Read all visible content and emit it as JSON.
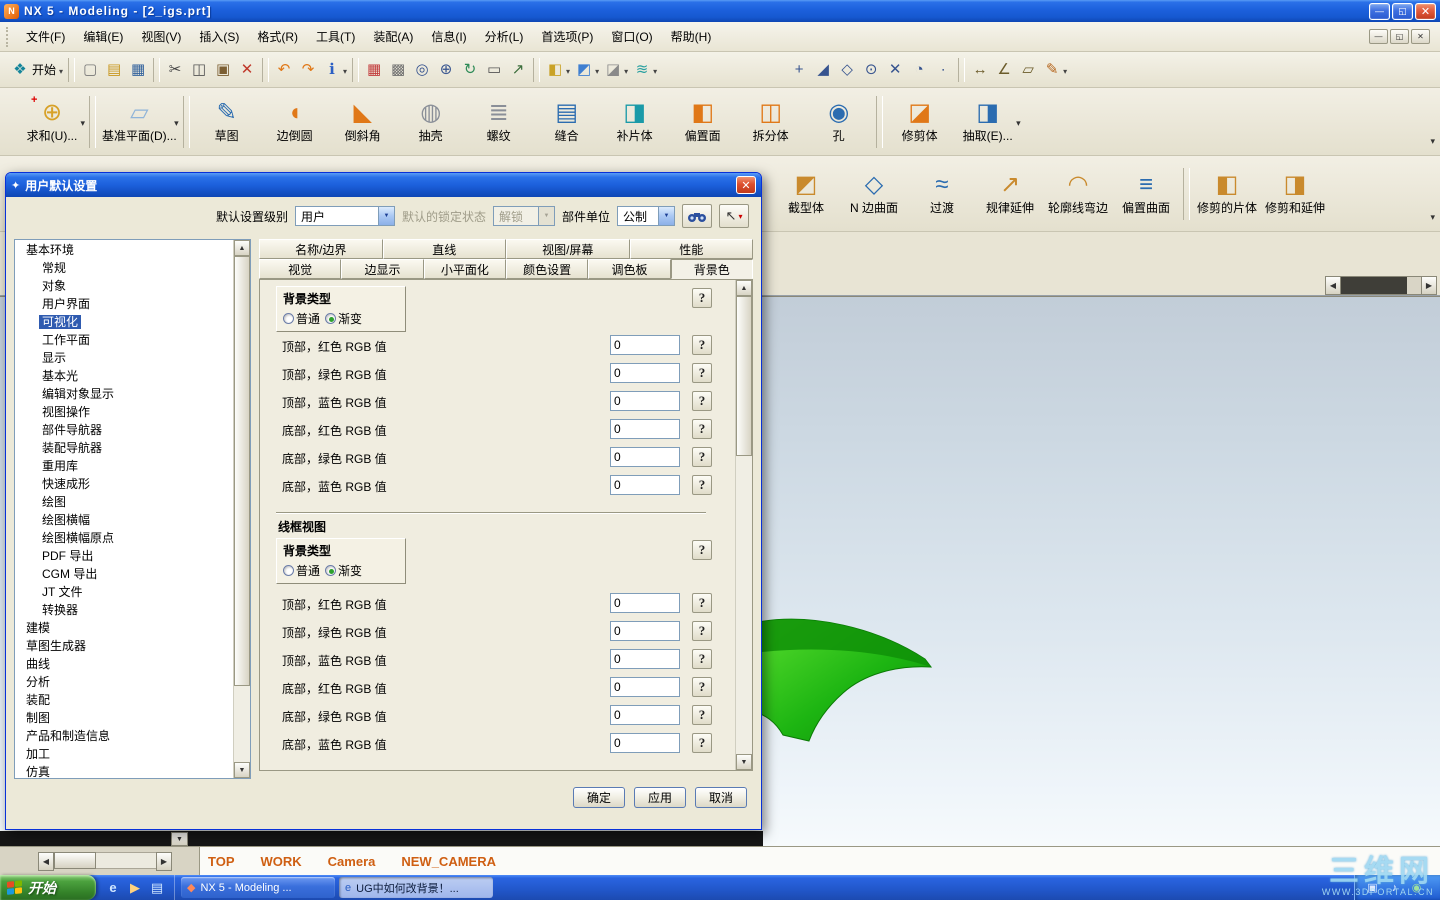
{
  "titlebar": {
    "title": "NX 5 - Modeling - [2_igs.prt]"
  },
  "menubar": {
    "items": [
      "文件(F)",
      "编辑(E)",
      "视图(V)",
      "插入(S)",
      "格式(R)",
      "工具(T)",
      "装配(A)",
      "信息(I)",
      "分析(L)",
      "首选项(P)",
      "窗口(O)",
      "帮助(H)"
    ]
  },
  "toolbar_small": {
    "items": [
      {
        "name": "nx-start-menu-button",
        "label": "开始",
        "glyph": "❖",
        "color": "#14859a",
        "caret": true
      },
      {
        "sep": true
      },
      {
        "name": "new-icon",
        "glyph": "▢",
        "color": "#777777"
      },
      {
        "name": "open-icon",
        "glyph": "▤",
        "color": "#c8971f"
      },
      {
        "name": "save-icon",
        "glyph": "▦",
        "color": "#33629c"
      },
      {
        "sep": true
      },
      {
        "name": "cut-icon",
        "glyph": "✂",
        "color": "#444444"
      },
      {
        "name": "copy-icon",
        "glyph": "◫",
        "color": "#555555"
      },
      {
        "name": "paste-icon",
        "glyph": "▣",
        "color": "#7c5f33"
      },
      {
        "name": "delete-icon",
        "glyph": "✕",
        "color": "#c0392b"
      },
      {
        "sep": true
      },
      {
        "name": "undo-icon",
        "glyph": "↶",
        "color": "#e07818"
      },
      {
        "name": "redo-icon",
        "glyph": "↷",
        "color": "#e07818"
      },
      {
        "name": "information-icon",
        "glyph": "ℹ",
        "color": "#2b5fc4",
        "caret": true
      },
      {
        "sep": true
      },
      {
        "name": "datum-display-icon",
        "glyph": "▦",
        "color": "#c23b3b"
      },
      {
        "name": "shaded-display-icon",
        "glyph": "▩",
        "color": "#6f6f6f"
      },
      {
        "name": "fit-view-icon",
        "glyph": "◎",
        "color": "#37548f"
      },
      {
        "name": "zoom-icon",
        "glyph": "⊕",
        "color": "#37548f"
      },
      {
        "name": "rotate-view-icon",
        "glyph": "↻",
        "color": "#2e8b57"
      },
      {
        "name": "snapshot-icon",
        "glyph": "▭",
        "color": "#555555"
      },
      {
        "name": "export-image-icon",
        "glyph": "↗",
        "color": "#3c6e3c"
      },
      {
        "sep": true
      },
      {
        "name": "orient-view-icon",
        "glyph": "◧",
        "color": "#c9a227",
        "caret": true
      },
      {
        "name": "isometric-view-icon",
        "glyph": "◩",
        "color": "#3f7fd1",
        "caret": true
      },
      {
        "name": "render-style-icon",
        "glyph": "◪",
        "color": "#8a8a8a",
        "caret": true
      },
      {
        "name": "palette-icon",
        "glyph": "≋",
        "color": "#2aa0a0",
        "caret": true
      },
      {
        "gap": true
      },
      {
        "name": "snap-point-icon",
        "glyph": "+",
        "color": "#37548f"
      },
      {
        "name": "snap-endpoint-icon",
        "glyph": "◢",
        "color": "#37548f"
      },
      {
        "name": "snap-midpoint-icon",
        "glyph": "◇",
        "color": "#37548f"
      },
      {
        "name": "snap-center-icon",
        "glyph": "⊙",
        "color": "#37548f"
      },
      {
        "name": "snap-intersection-icon",
        "glyph": "✕",
        "color": "#37548f"
      },
      {
        "name": "snap-quadrant-icon",
        "glyph": "◔",
        "color": "#37548f"
      },
      {
        "name": "snap-node-icon",
        "glyph": "∙",
        "color": "#37548f"
      },
      {
        "sep": true
      },
      {
        "name": "measure-distance-icon",
        "glyph": "↔",
        "color": "#6b5b2a"
      },
      {
        "name": "measure-angle-icon",
        "glyph": "∠",
        "color": "#6b5b2a"
      },
      {
        "name": "measure-body-icon",
        "glyph": "▱",
        "color": "#6b5b2a"
      },
      {
        "name": "annotation-icon",
        "glyph": "✎",
        "color": "#b5651d",
        "caret": true
      }
    ]
  },
  "toolbar_features": {
    "items": [
      {
        "name": "feature-unite-button",
        "label": "求和(U)...",
        "glyph": "⊕",
        "color": "#d7a128",
        "caret": true,
        "plus": true
      },
      {
        "sep": true
      },
      {
        "name": "feature-datum-plane-button",
        "label": "基准平面(D)...",
        "glyph": "▱",
        "color": "#8fb4d9",
        "caret": true
      },
      {
        "sep": true
      },
      {
        "name": "feature-sketch-button",
        "label": "草图",
        "glyph": "✎",
        "color": "#2b6cb0"
      },
      {
        "name": "feature-edge-blend-button",
        "label": "边倒圆",
        "glyph": "◖",
        "color": "#e07818"
      },
      {
        "name": "feature-chamfer-button",
        "label": "倒斜角",
        "glyph": "◣",
        "color": "#e07818"
      },
      {
        "name": "feature-shell-button",
        "label": "抽壳",
        "glyph": "◍",
        "color": "#8a8f98"
      },
      {
        "name": "feature-thread-button",
        "label": "螺纹",
        "glyph": "≣",
        "color": "#8a8f98"
      },
      {
        "name": "feature-sew-button",
        "label": "缝合",
        "glyph": "▤",
        "color": "#2b6cb0"
      },
      {
        "name": "feature-patch-body-button",
        "label": "补片体",
        "glyph": "◨",
        "color": "#1a9aa8"
      },
      {
        "name": "feature-offset-face-button",
        "label": "偏置面",
        "glyph": "◧",
        "color": "#e07818"
      },
      {
        "name": "feature-split-body-button",
        "label": "拆分体",
        "glyph": "◫",
        "color": "#e07818"
      },
      {
        "name": "feature-hole-button",
        "label": "孔",
        "glyph": "◉",
        "color": "#2b6cb0"
      },
      {
        "sep": true
      },
      {
        "name": "feature-trim-body-button",
        "label": "修剪体",
        "glyph": "◪",
        "color": "#e07818"
      },
      {
        "name": "feature-extract-button",
        "label": "抽取(E)...",
        "glyph": "◨",
        "color": "#2b6cb0",
        "caret": true
      }
    ]
  },
  "toolbar_surface": {
    "items": [
      {
        "name": "surface-section-body-button",
        "label": "截型体",
        "glyph": "◩",
        "color": "#c98a2d"
      },
      {
        "name": "surface-n-sided-button",
        "label": "N 边曲面",
        "glyph": "◇",
        "color": "#2b6cb0"
      },
      {
        "name": "surface-transition-button",
        "label": "过渡",
        "glyph": "≈",
        "color": "#2b6cb0"
      },
      {
        "name": "surface-law-extension-button",
        "label": "规律延伸",
        "glyph": "↗",
        "color": "#c98a2d"
      },
      {
        "name": "surface-flange-button",
        "label": "轮廓线弯边",
        "glyph": "◠",
        "color": "#c98a2d"
      },
      {
        "name": "surface-offset-surface-button",
        "label": "偏置曲面",
        "glyph": "≡",
        "color": "#2b6cb0"
      },
      {
        "sep": true
      },
      {
        "name": "surface-trimmed-sheet-button",
        "label": "修剪的片体",
        "glyph": "◧",
        "color": "#c98a2d"
      },
      {
        "name": "surface-trim-extend-button",
        "label": "修剪和延伸",
        "gl ": "",
        "glyph": "◨",
        "color": "#c98a2d"
      }
    ]
  },
  "dialog": {
    "title": "用户默认设置",
    "level_label": "默认设置级别",
    "level_value": "用户",
    "lock_label": "默认的锁定状态",
    "lock_value": "解锁",
    "units_label": "部件单位",
    "units_value": "公制",
    "tree": [
      {
        "label": "基本环境",
        "indent": 0
      },
      {
        "label": "常规",
        "indent": 1
      },
      {
        "label": "对象",
        "indent": 1
      },
      {
        "label": "用户界面",
        "indent": 1
      },
      {
        "label": "可视化",
        "indent": 1,
        "selected": true
      },
      {
        "label": "工作平面",
        "indent": 1
      },
      {
        "label": "显示",
        "indent": 1
      },
      {
        "label": "基本光",
        "indent": 1
      },
      {
        "label": "编辑对象显示",
        "indent": 1
      },
      {
        "label": "视图操作",
        "indent": 1
      },
      {
        "label": "部件导航器",
        "indent": 1
      },
      {
        "label": "装配导航器",
        "indent": 1
      },
      {
        "label": "重用库",
        "indent": 1
      },
      {
        "label": "快速成形",
        "indent": 1
      },
      {
        "label": "绘图",
        "indent": 1
      },
      {
        "label": "绘图横幅",
        "indent": 1
      },
      {
        "label": "绘图横幅原点",
        "indent": 1
      },
      {
        "label": "PDF 导出",
        "indent": 1
      },
      {
        "label": "CGM 导出",
        "indent": 1
      },
      {
        "label": "JT 文件",
        "indent": 1
      },
      {
        "label": "转换器",
        "indent": 1
      },
      {
        "label": "建模",
        "indent": 0
      },
      {
        "label": "草图生成器",
        "indent": 0
      },
      {
        "label": "曲线",
        "indent": 0
      },
      {
        "label": "分析",
        "indent": 0
      },
      {
        "label": "装配",
        "indent": 0
      },
      {
        "label": "制图",
        "indent": 0
      },
      {
        "label": "产品和制造信息",
        "indent": 0
      },
      {
        "label": "加工",
        "indent": 0
      },
      {
        "label": "仿真",
        "indent": 0
      }
    ],
    "tabs_row1": [
      {
        "label": "名称/边界"
      },
      {
        "label": "直线"
      },
      {
        "label": "视图/屏幕"
      },
      {
        "label": "性能"
      }
    ],
    "tabs_row2": [
      {
        "label": "视觉"
      },
      {
        "label": "边显示"
      },
      {
        "label": "小平面化"
      },
      {
        "label": "颜色设置"
      },
      {
        "label": "调色板"
      },
      {
        "label": "背景色",
        "active": true
      }
    ],
    "shaded": {
      "group_title": "背景类型",
      "radio_options": [
        {
          "label": "普通"
        },
        {
          "label": "渐变",
          "selected": true
        }
      ],
      "rows": [
        {
          "label": "顶部，红色 RGB 值",
          "value": "0"
        },
        {
          "label": "顶部，绿色 RGB 值",
          "value": "0"
        },
        {
          "label": "顶部，蓝色 RGB 值",
          "value": "0"
        },
        {
          "label": "底部，红色 RGB 值",
          "value": "0"
        },
        {
          "label": "底部，绿色 RGB 值",
          "value": "0"
        },
        {
          "label": "底部，蓝色 RGB 值",
          "value": "0"
        }
      ]
    },
    "wireframe": {
      "section_title": "线框视图",
      "group_title": "背景类型",
      "radio_options": [
        {
          "label": "普通"
        },
        {
          "label": "渐变",
          "selected": true
        }
      ],
      "rows": [
        {
          "label": "顶部，红色 RGB 值",
          "value": "0"
        },
        {
          "label": "顶部，绿色 RGB 值",
          "value": "0"
        },
        {
          "label": "顶部，蓝色 RGB 值",
          "value": "0"
        },
        {
          "label": "底部，红色 RGB 值",
          "value": "0"
        },
        {
          "label": "底部，绿色 RGB 值",
          "value": "0"
        },
        {
          "label": "底部，蓝色 RGB 值",
          "value": "0"
        }
      ]
    },
    "buttons": {
      "ok": "确定",
      "apply": "应用",
      "cancel": "取消"
    }
  },
  "statusbar": {
    "fields": [
      "TOP",
      "WORK",
      "Camera",
      "NEW_CAMERA"
    ]
  },
  "taskbar": {
    "start_label": "开始",
    "quicklaunch": [
      {
        "name": "quicklaunch-ie-icon",
        "glyph": "e",
        "color": "#cfe6ff"
      },
      {
        "name": "quicklaunch-player-icon",
        "glyph": "▶",
        "color": "#ffd27f"
      },
      {
        "name": "quicklaunch-desktop-icon",
        "glyph": "▤",
        "color": "#cfe6ff"
      }
    ],
    "tasks": [
      {
        "name": "task-nx-button",
        "label": "NX 5 - Modeling ...",
        "glyph": "◆",
        "color": "#ff8858"
      },
      {
        "name": "task-browser-button",
        "label": "UG中如何改背景！...",
        "glyph": "e",
        "color": "#2b5fc4",
        "active": true
      }
    ],
    "tray": [
      {
        "name": "tray-input-icon",
        "glyph": "▣",
        "color": "#dce8ff"
      },
      {
        "name": "tray-volume-icon",
        "glyph": "♪",
        "color": "#e8f2ff"
      },
      {
        "name": "tray-shield-icon",
        "glyph": "◉",
        "color": "#9fe09f"
      }
    ]
  },
  "watermark": {
    "title": "三维网",
    "subtitle": "WWW.3DPORTAL.CN"
  }
}
